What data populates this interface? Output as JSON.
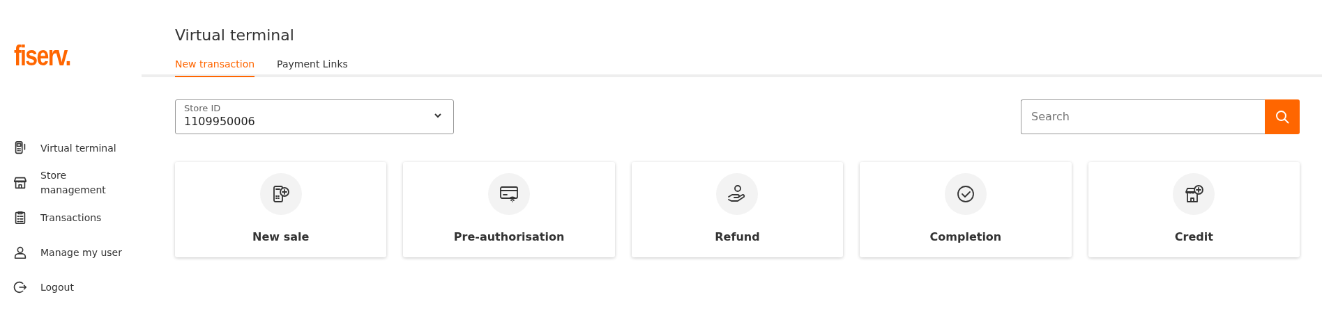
{
  "logo": "fiserv.",
  "sidebar": {
    "items": [
      {
        "label": "Virtual terminal"
      },
      {
        "label": "Store management"
      },
      {
        "label": "Transactions"
      },
      {
        "label": "Manage my user"
      },
      {
        "label": "Logout"
      }
    ]
  },
  "page_title": "Virtual terminal",
  "tabs": [
    {
      "label": "New transaction",
      "selected": true
    },
    {
      "label": "Payment Links",
      "selected": false
    }
  ],
  "store_select": {
    "label": "Store ID",
    "value": "1109950006"
  },
  "search": {
    "placeholder": "Search"
  },
  "actions": [
    {
      "label": "New sale"
    },
    {
      "label": "Pre-authorisation"
    },
    {
      "label": "Refund"
    },
    {
      "label": "Completion"
    },
    {
      "label": "Credit"
    }
  ]
}
